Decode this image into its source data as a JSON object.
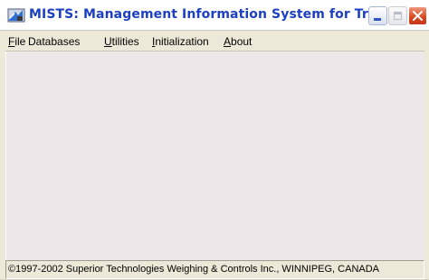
{
  "window": {
    "title": "MISTS:  Management Information System for Tru...",
    "icon": "truck-scale-icon",
    "controls": {
      "minimize": "minimize-icon",
      "maximize": "maximize-icon",
      "close": "close-icon"
    }
  },
  "menubar": {
    "items": [
      {
        "accel": "F",
        "rest": "ile"
      },
      {
        "accel": "",
        "rest": "Databases"
      },
      {
        "accel": "U",
        "rest": "tilities"
      },
      {
        "accel": "I",
        "rest": "nitialization"
      },
      {
        "accel": "A",
        "rest": "bout"
      }
    ]
  },
  "statusbar": {
    "text": "©1997-2002 Superior Technologies Weighing & Controls Inc., WINNIPEG, CANADA"
  },
  "colors": {
    "title_text": "#1d3fc1",
    "client_background": "#ede7e9",
    "chrome": "#ece9d8",
    "close_button": "#d8461f"
  }
}
